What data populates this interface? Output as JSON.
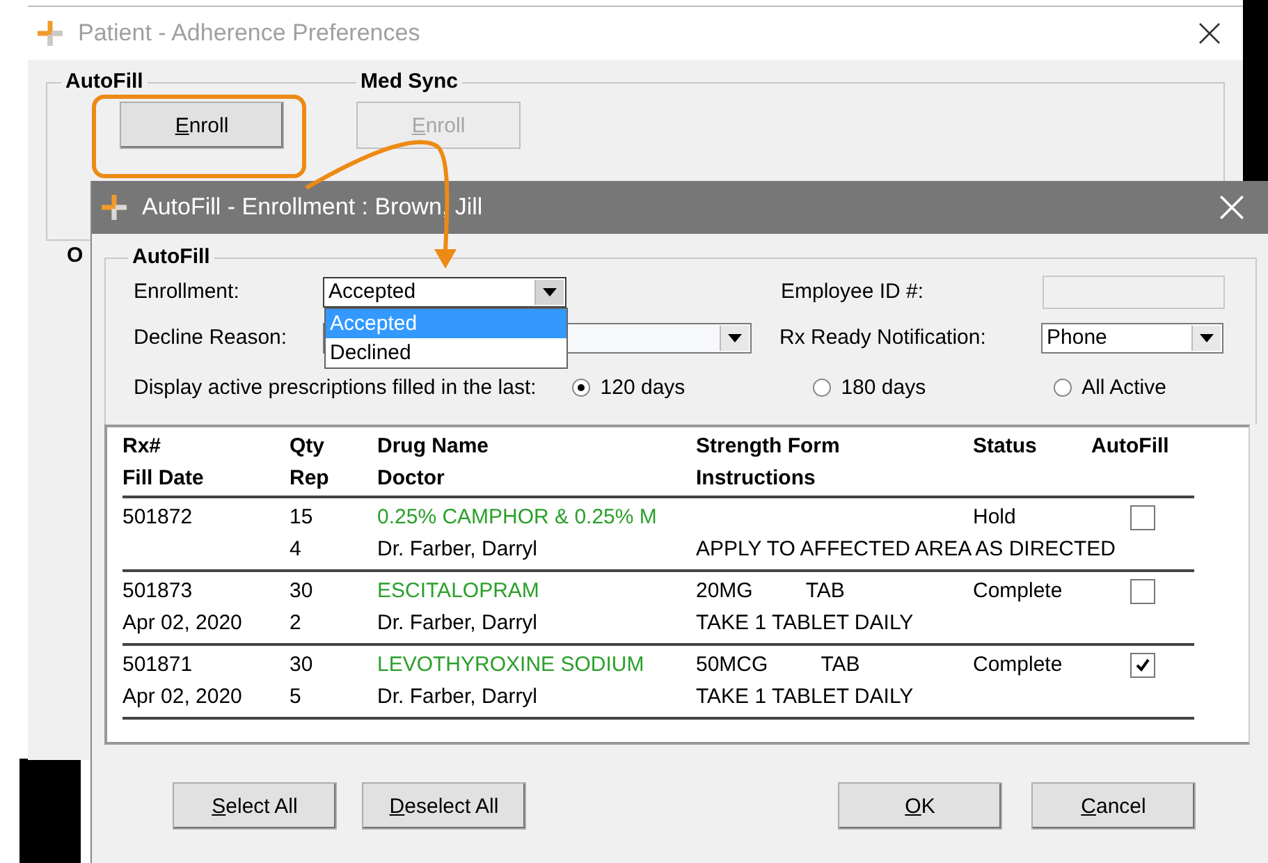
{
  "parent_window": {
    "title": "Patient - Adherence Preferences",
    "autofill_group": {
      "label": "AutoFill",
      "enroll_button": {
        "label": "Enroll",
        "disabled": false
      }
    },
    "med_sync_group": {
      "label": "Med Sync",
      "enroll_button": {
        "label": "Enroll",
        "disabled": true
      }
    },
    "partial_group_label": "O"
  },
  "dialog": {
    "title": "AutoFill - Enrollment : Brown, Jill",
    "group_label": "AutoFill",
    "enrollment": {
      "label": "Enrollment:",
      "value": "Accepted",
      "expanded": true,
      "options": [
        {
          "label": "Accepted",
          "selected": true
        },
        {
          "label": "Declined",
          "selected": false
        }
      ]
    },
    "employee_id": {
      "label": "Employee ID #:",
      "disabled": true
    },
    "decline_reason": {
      "label": "Decline Reason:"
    },
    "rx_ready_notification": {
      "label": "Rx Ready Notification:",
      "value": "Phone"
    },
    "display_period": {
      "label": "Display active prescriptions filled in the last:",
      "options": [
        {
          "label": "120 days",
          "selected": true
        },
        {
          "label": "180 days",
          "selected": false
        },
        {
          "label": "All Active",
          "selected": false
        }
      ]
    },
    "table": {
      "columns": [
        {
          "line_1": "Rx#",
          "line_2": "Fill Date"
        },
        {
          "line_1": "Qty",
          "line_2": "Rep"
        },
        {
          "line_1": "Drug Name",
          "line_2": "Doctor"
        },
        {
          "line_1": "Strength Form",
          "line_2": "Instructions"
        },
        {
          "line_1": "Status"
        },
        {
          "line_1": "AutoFill"
        }
      ],
      "rows": [
        {
          "rx": "501872",
          "qty": "15",
          "rep": "4",
          "drug_name": "0.25% CAMPHOR & 0.25% M",
          "doctor": "Dr. Farber, Darryl",
          "instructions": "APPLY TO AFFECTED AREA AS DIRECTED",
          "status": "Hold",
          "autofill": false
        },
        {
          "rx": "501873",
          "fill_date": "Apr 02, 2020",
          "qty": "30",
          "rep": "2",
          "drug_name": "ESCITALOPRAM",
          "doctor": "Dr. Farber, Darryl",
          "strength": "20MG",
          "form": "TAB",
          "instructions": "TAKE 1 TABLET DAILY",
          "status": "Complete",
          "autofill": false
        },
        {
          "rx": "501871",
          "fill_date": "Apr 02, 2020",
          "qty": "30",
          "rep": "5",
          "drug_name": "LEVOTHYROXINE SODIUM",
          "doctor": "Dr. Farber, Darryl",
          "strength": "50MCG",
          "form": "TAB",
          "instructions": "TAKE 1 TABLET DAILY",
          "status": "Complete",
          "autofill": true
        }
      ]
    },
    "buttons_left": [
      "Select All",
      "Deselect All"
    ],
    "buttons_right": [
      "OK",
      "Cancel"
    ]
  }
}
